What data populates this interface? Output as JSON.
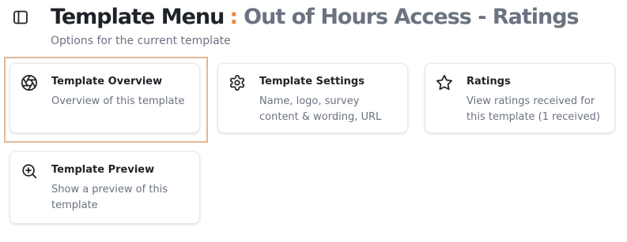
{
  "header": {
    "title_main": "Template Menu",
    "title_separator": ":",
    "title_sub": "Out of Hours Access - Ratings",
    "subtitle": "Options for the current template"
  },
  "cards": [
    {
      "title": "Template Overview",
      "description": "Overview of this template",
      "icon": "aperture-icon"
    },
    {
      "title": "Template Settings",
      "description": "Name, logo, survey content & wording, URL",
      "icon": "gear-icon"
    },
    {
      "title": "Ratings",
      "description": "View ratings received for this template (1 received)",
      "icon": "star-icon"
    },
    {
      "title": "Template Preview",
      "description": "Show a preview of this template",
      "icon": "zoom-in-icon"
    }
  ],
  "colors": {
    "accent": "#f08a3c",
    "title_sub": "#6b7280",
    "focus_ring": "#e0b898"
  }
}
